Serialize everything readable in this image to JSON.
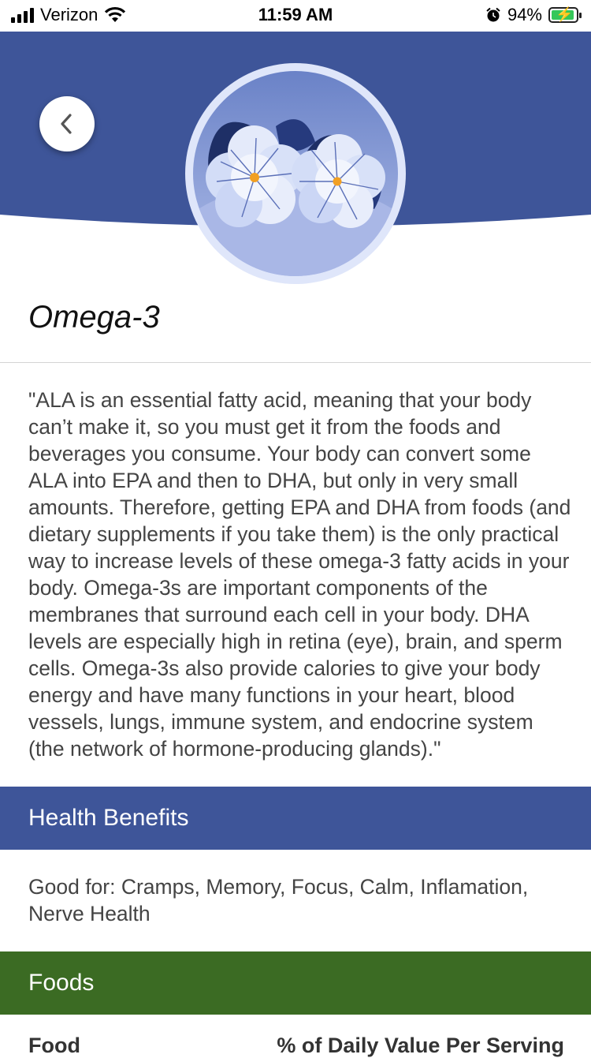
{
  "status_bar": {
    "carrier": "Verizon",
    "time": "11:59 AM",
    "battery": "94%"
  },
  "nutrient": {
    "title": "Omega-3",
    "description": "\"ALA is an essential fatty acid, meaning that your body can’t make it, so you must get it from the foods and beverages you consume. Your body can convert some ALA into EPA and then to DHA, but only in very small amounts. Therefore, getting EPA and DHA from foods (and dietary supplements if you take them) is the only practical way to increase levels of these omega-3 fatty acids in your body.  Omega-3s are important components of the membranes that surround each cell in your body. DHA levels are especially high in retina (eye), brain, and sperm cells. Omega-3s also provide calories to give your body energy and have many functions in your heart, blood vessels, lungs, immune system, and endocrine system (the network of hormone-producing glands).\""
  },
  "health_benefits": {
    "heading": "Health Benefits",
    "text": "Good for: Cramps, Memory, Focus, Calm, Inflamation, Nerve Health"
  },
  "foods": {
    "heading": "Foods",
    "columns": [
      "Food",
      "% of Daily Value Per Serving"
    ]
  },
  "colors": {
    "header_blue": "#3e5599",
    "foods_green": "#3b6b23",
    "avatar_ring": "#c9d3f2"
  },
  "icons": {
    "back": "chevron-left-icon",
    "avatar": "flower-icon"
  }
}
